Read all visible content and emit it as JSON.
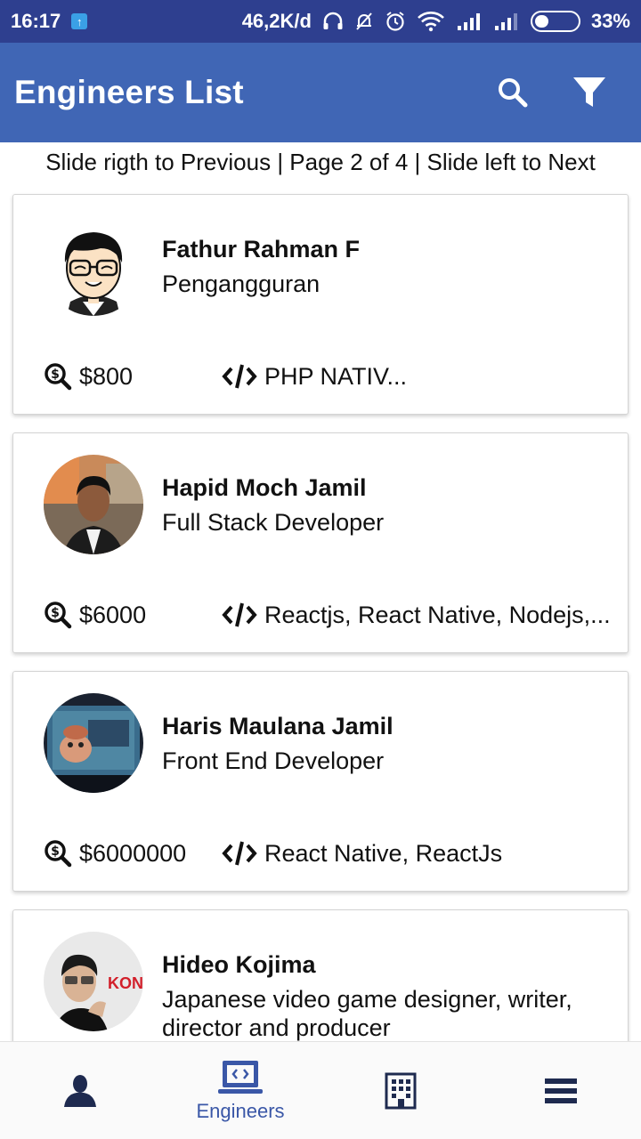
{
  "status_bar": {
    "time": "16:17",
    "speed": "46,2K/d",
    "battery": "33%",
    "battery_level": 0.33
  },
  "app_bar": {
    "title": "Engineers List",
    "actions": [
      "search-icon",
      "filter-icon"
    ]
  },
  "pager_text": "Slide rigth to Previous | Page 2 of 4 | Slide left to Next",
  "engineers": [
    {
      "name": "Fathur Rahman F",
      "role": "Pengangguran",
      "salary": "$800",
      "skills": "PHP NATIV..."
    },
    {
      "name": "Hapid Moch Jamil",
      "role": "Full Stack Developer",
      "salary": "$6000",
      "skills": "Reactjs, React Native, Nodejs,..."
    },
    {
      "name": "Haris Maulana Jamil",
      "role": "Front End Developer",
      "salary": "$6000000",
      "skills": "React Native, ReactJs"
    },
    {
      "name": "Hideo Kojima",
      "role": "Japanese video game designer, writer, director and producer",
      "salary": "",
      "skills": "",
      "avatar_text": "KON"
    }
  ],
  "bottom_nav": {
    "active": "Engineers",
    "items": [
      "profile-icon",
      "engineers-icon",
      "company-icon",
      "menu-icon"
    ],
    "engineers_label": "Engineers"
  },
  "colors": {
    "status_bar": "#2e3f8f",
    "app_bar": "#4066b5",
    "nav_active": "#3a57a7",
    "nav_icon": "#1e2a4f"
  }
}
